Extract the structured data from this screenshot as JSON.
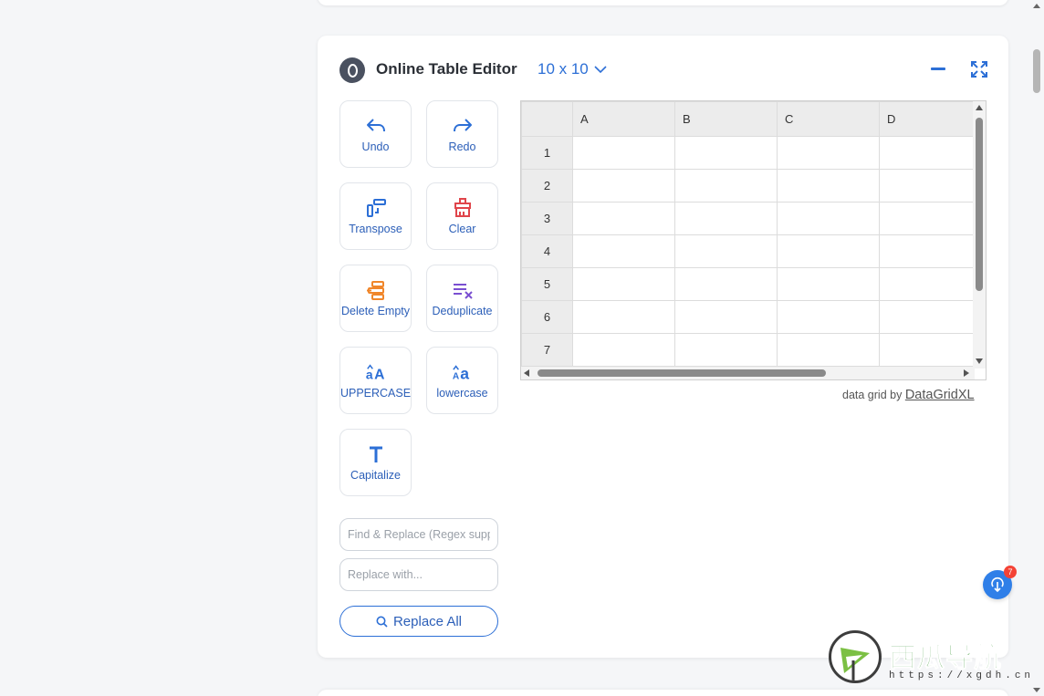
{
  "tool": {
    "title": "Online Table Editor",
    "size_label": "10 x 10"
  },
  "toolbar": {
    "undo": "Undo",
    "redo": "Redo",
    "transpose": "Transpose",
    "clear": "Clear",
    "delete_empty": "Delete Empty",
    "deduplicate": "Deduplicate",
    "uppercase": "UPPERCASE",
    "lowercase": "lowercase",
    "capitalize": "Capitalize"
  },
  "find_replace": {
    "find_placeholder": "Find & Replace (Regex supported)",
    "replace_placeholder": "Replace with...",
    "replace_all_label": "Replace All"
  },
  "grid": {
    "columns": [
      "A",
      "B",
      "C",
      "D"
    ],
    "rows": [
      "1",
      "2",
      "3",
      "4",
      "5",
      "6",
      "7"
    ],
    "credit_prefix": "data grid by",
    "credit_link": "DataGridXL"
  },
  "float_badge_count": "7",
  "watermark": {
    "brand": "西瓜导航",
    "url": "https://xgdh.cn"
  },
  "colors": {
    "accent": "#2c6fd6",
    "clear_icon": "#e0454b",
    "delete_empty_icon": "#f0862a",
    "dedupe_icon": "#7a4fd1"
  }
}
